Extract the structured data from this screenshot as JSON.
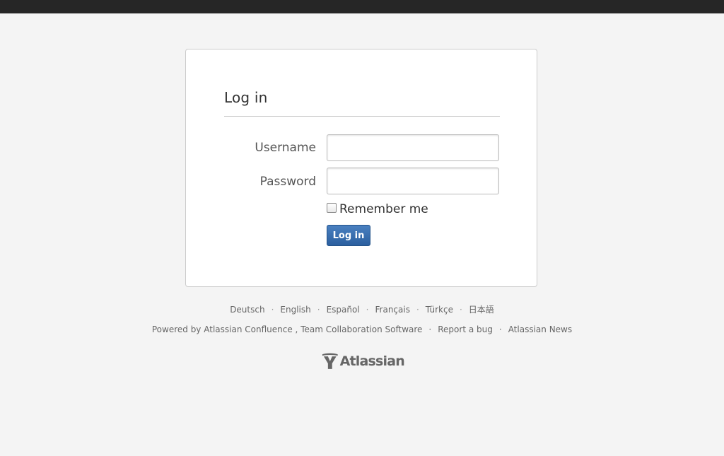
{
  "login": {
    "heading": "Log in",
    "username_label": "Username",
    "username_value": "",
    "password_label": "Password",
    "password_value": "",
    "remember_label": "Remember me",
    "remember_checked": false,
    "submit_label": "Log in"
  },
  "languages": [
    "Deutsch",
    "English",
    "Español",
    "Français",
    "Türkçe",
    "日本語"
  ],
  "separator": "·",
  "footer": {
    "powered_by_prefix": "Powered by",
    "product_link": "Atlassian Confluence",
    "comma": ",",
    "tagline": "Team Collaboration Software",
    "report_bug": "Report a bug",
    "news": "Atlassian News"
  },
  "logo": {
    "text": "Atlassian",
    "icon": "atlassian-logo-icon"
  },
  "colors": {
    "top_bar": "#262626",
    "page_background": "#f4f4f4",
    "button_primary": "#3366aa"
  }
}
